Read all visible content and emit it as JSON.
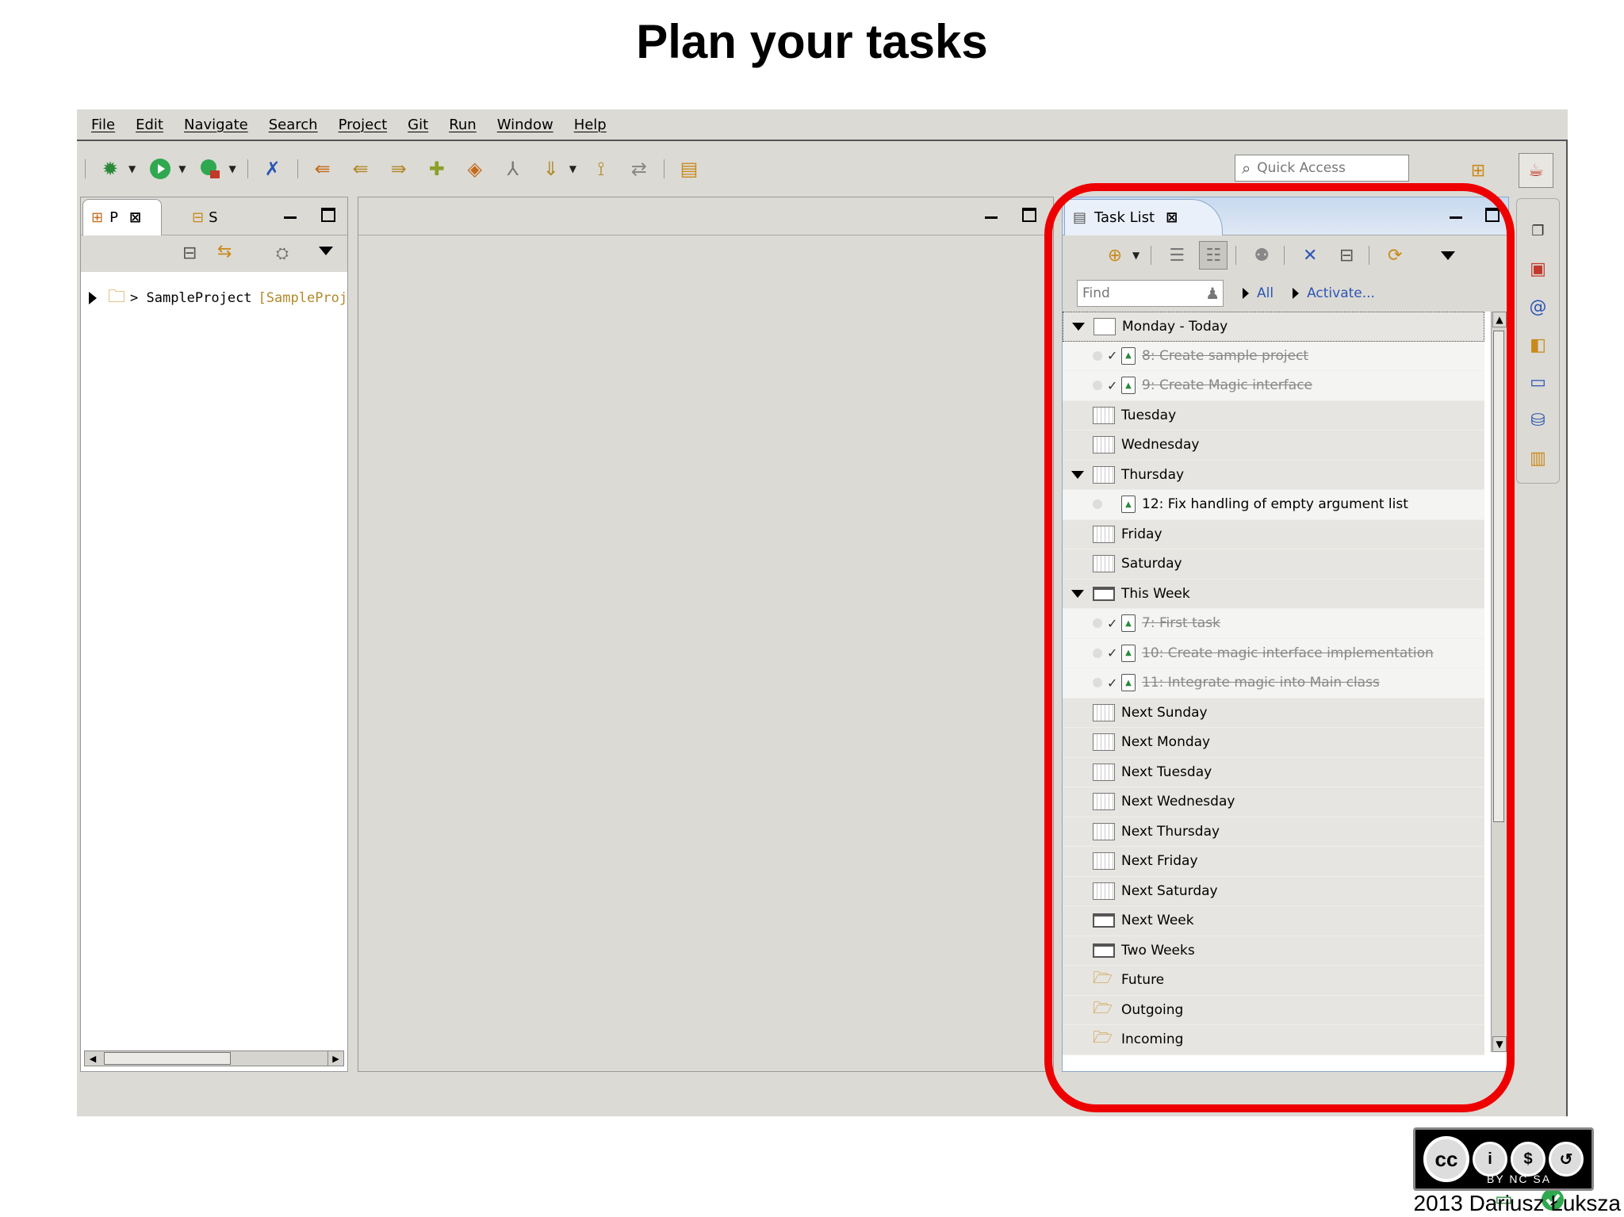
{
  "slide": {
    "title": "Plan your tasks",
    "author": "2013 Dariusz Łuksza",
    "license_labels": "BY NC SA"
  },
  "menubar": {
    "items": [
      "File",
      "Edit",
      "Navigate",
      "Search",
      "Project",
      "Git",
      "Run",
      "Window",
      "Help"
    ]
  },
  "toolbar": {
    "quick_access_placeholder": "Quick Access"
  },
  "project_explorer": {
    "tab_label": "P",
    "second_tab_label": "S",
    "tree": [
      {
        "name": "> SampleProject",
        "suffix": "[SampleProje"
      }
    ]
  },
  "task_list": {
    "tab_label": "Task List",
    "find_placeholder": "Find",
    "filter_all": "All",
    "activate": "Activate...",
    "rows": [
      {
        "kind": "cat",
        "icon": "calendar-today",
        "expanded": true,
        "label": "Monday - Today",
        "selected": true
      },
      {
        "kind": "task",
        "done": true,
        "label": "8: Create sample project"
      },
      {
        "kind": "task",
        "done": true,
        "label": "9: Create Magic interface"
      },
      {
        "kind": "cat",
        "icon": "calendar",
        "expanded": false,
        "label": "Tuesday"
      },
      {
        "kind": "cat",
        "icon": "calendar",
        "expanded": false,
        "label": "Wednesday"
      },
      {
        "kind": "cat",
        "icon": "calendar",
        "expanded": true,
        "label": "Thursday"
      },
      {
        "kind": "task",
        "done": false,
        "label": "12: Fix handling of empty argument list"
      },
      {
        "kind": "cat",
        "icon": "calendar",
        "expanded": false,
        "label": "Friday"
      },
      {
        "kind": "cat",
        "icon": "calendar",
        "expanded": false,
        "label": "Saturday"
      },
      {
        "kind": "cat",
        "icon": "week",
        "expanded": true,
        "label": "This Week"
      },
      {
        "kind": "task",
        "done": true,
        "label": "7: First task"
      },
      {
        "kind": "task",
        "done": true,
        "label": "10: Create magic interface implementation"
      },
      {
        "kind": "task",
        "done": true,
        "label": "11: Integrate magic into Main class"
      },
      {
        "kind": "cat",
        "icon": "calendar",
        "expanded": false,
        "label": "Next Sunday"
      },
      {
        "kind": "cat",
        "icon": "calendar",
        "expanded": false,
        "label": "Next Monday"
      },
      {
        "kind": "cat",
        "icon": "calendar",
        "expanded": false,
        "label": "Next Tuesday"
      },
      {
        "kind": "cat",
        "icon": "calendar",
        "expanded": false,
        "label": "Next Wednesday"
      },
      {
        "kind": "cat",
        "icon": "calendar",
        "expanded": false,
        "label": "Next Thursday"
      },
      {
        "kind": "cat",
        "icon": "calendar",
        "expanded": false,
        "label": "Next Friday"
      },
      {
        "kind": "cat",
        "icon": "calendar",
        "expanded": false,
        "label": "Next Saturday"
      },
      {
        "kind": "cat",
        "icon": "week",
        "expanded": false,
        "label": "Next Week"
      },
      {
        "kind": "cat",
        "icon": "week",
        "expanded": false,
        "label": "Two Weeks"
      },
      {
        "kind": "cat",
        "icon": "folder",
        "expanded": false,
        "label": "Future"
      },
      {
        "kind": "cat",
        "icon": "folder",
        "expanded": false,
        "label": "Outgoing"
      },
      {
        "kind": "cat",
        "icon": "folder",
        "expanded": false,
        "label": "Incoming"
      }
    ]
  },
  "colors": {
    "highlight": "#ee0000",
    "link": "#2b56b5",
    "ide_background": "#dcdad5"
  }
}
